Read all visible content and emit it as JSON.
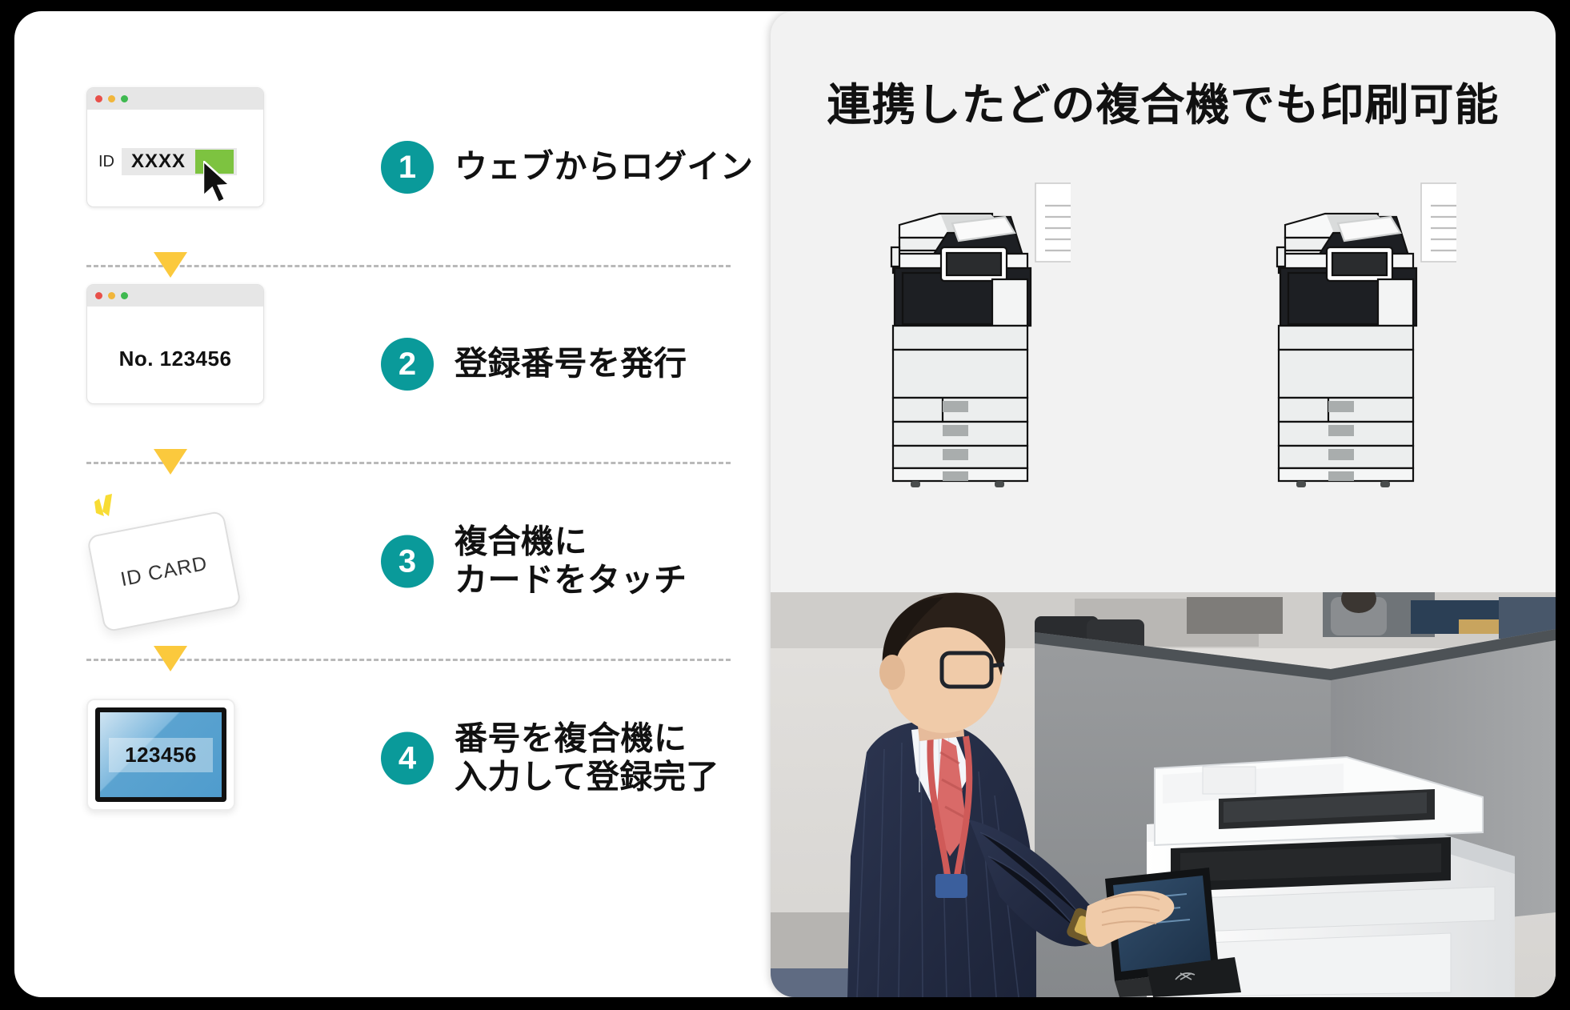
{
  "left_card": {
    "steps": [
      {
        "number": "1",
        "label": "ウェブからログイン",
        "visual": "browser-login-window",
        "id_label": "ID",
        "id_value": "XXXX"
      },
      {
        "number": "2",
        "label": "登録番号を発行",
        "visual": "browser-number-window",
        "number_text": "No. 123456"
      },
      {
        "number": "3",
        "label": "複合機に\nカードをタッチ",
        "visual": "id-card",
        "card_text": "ID CARD"
      },
      {
        "number": "4",
        "label": "番号を複合機に\n入力して登録完了",
        "visual": "tablet",
        "screen_number": "123456"
      }
    ]
  },
  "right_panel": {
    "headline": "連携したどの複合機でも印刷可能",
    "devices": [
      {
        "name": "multifunction-printer-1"
      },
      {
        "name": "multifunction-printer-2"
      }
    ],
    "photo_caption": ""
  },
  "colors": {
    "accent_teal": "#0a9a9a",
    "arrow_yellow": "#fbc93d",
    "button_green": "#7dc340",
    "panel_gray": "#f2f2f2",
    "background": "#000000"
  }
}
